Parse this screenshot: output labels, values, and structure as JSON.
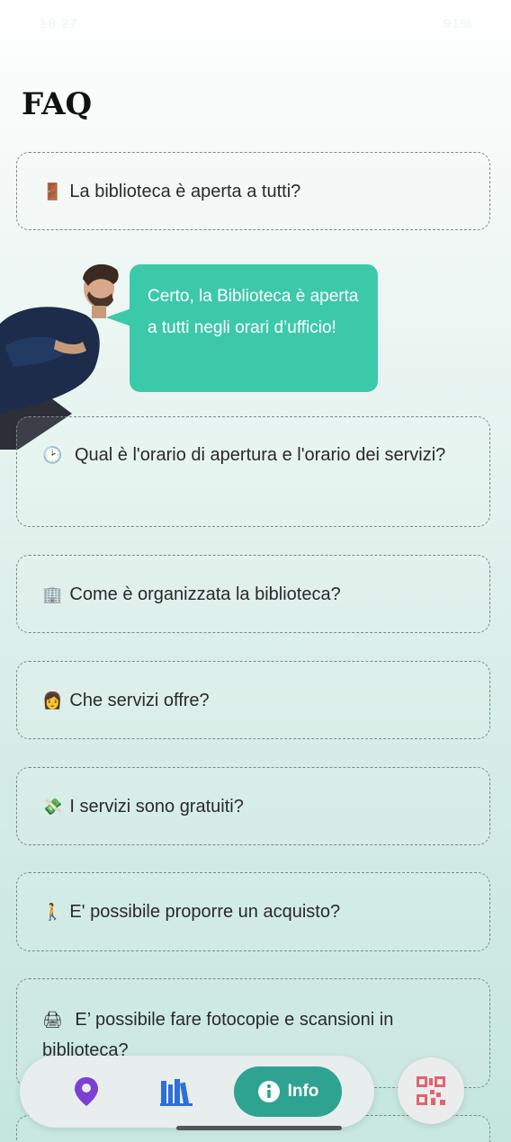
{
  "status_bar": {
    "time": "18:27",
    "right": "91%"
  },
  "page": {
    "title": "FAQ"
  },
  "faqs": [
    {
      "emoji": "🚪",
      "question": "La biblioteca è aperta a tutti?"
    },
    {
      "emoji": "🕑",
      "question": "Qual è l'orario di apertura e l'orario dei servizi?"
    },
    {
      "emoji": "🏢",
      "question": "Come è organizzata la biblioteca?"
    },
    {
      "emoji": "👩",
      "question": "Che servizi offre?"
    },
    {
      "emoji": "💸",
      "question": "I servizi sono gratuiti?"
    },
    {
      "emoji": "🚶",
      "question": "E' possibile proporre un acquisto?"
    },
    {
      "emoji": "🖨",
      "question": "E’ possibile fare fotocopie e scansioni in biblioteca?"
    }
  ],
  "assistant": {
    "answer": "Certo, la Biblioteca è aperta a tutti negli orari d’ufficio!"
  },
  "nav": {
    "info_label": "Info",
    "icons": [
      "location-pin-icon",
      "books-icon",
      "info-icon",
      "qr-code-icon"
    ]
  },
  "colors": {
    "accent": "#2ea392",
    "bubble": "#3cc9aa",
    "location_icon": "#7b3fd6",
    "books_icon": "#2f6fd6",
    "qr_icon": "#e2646d"
  }
}
